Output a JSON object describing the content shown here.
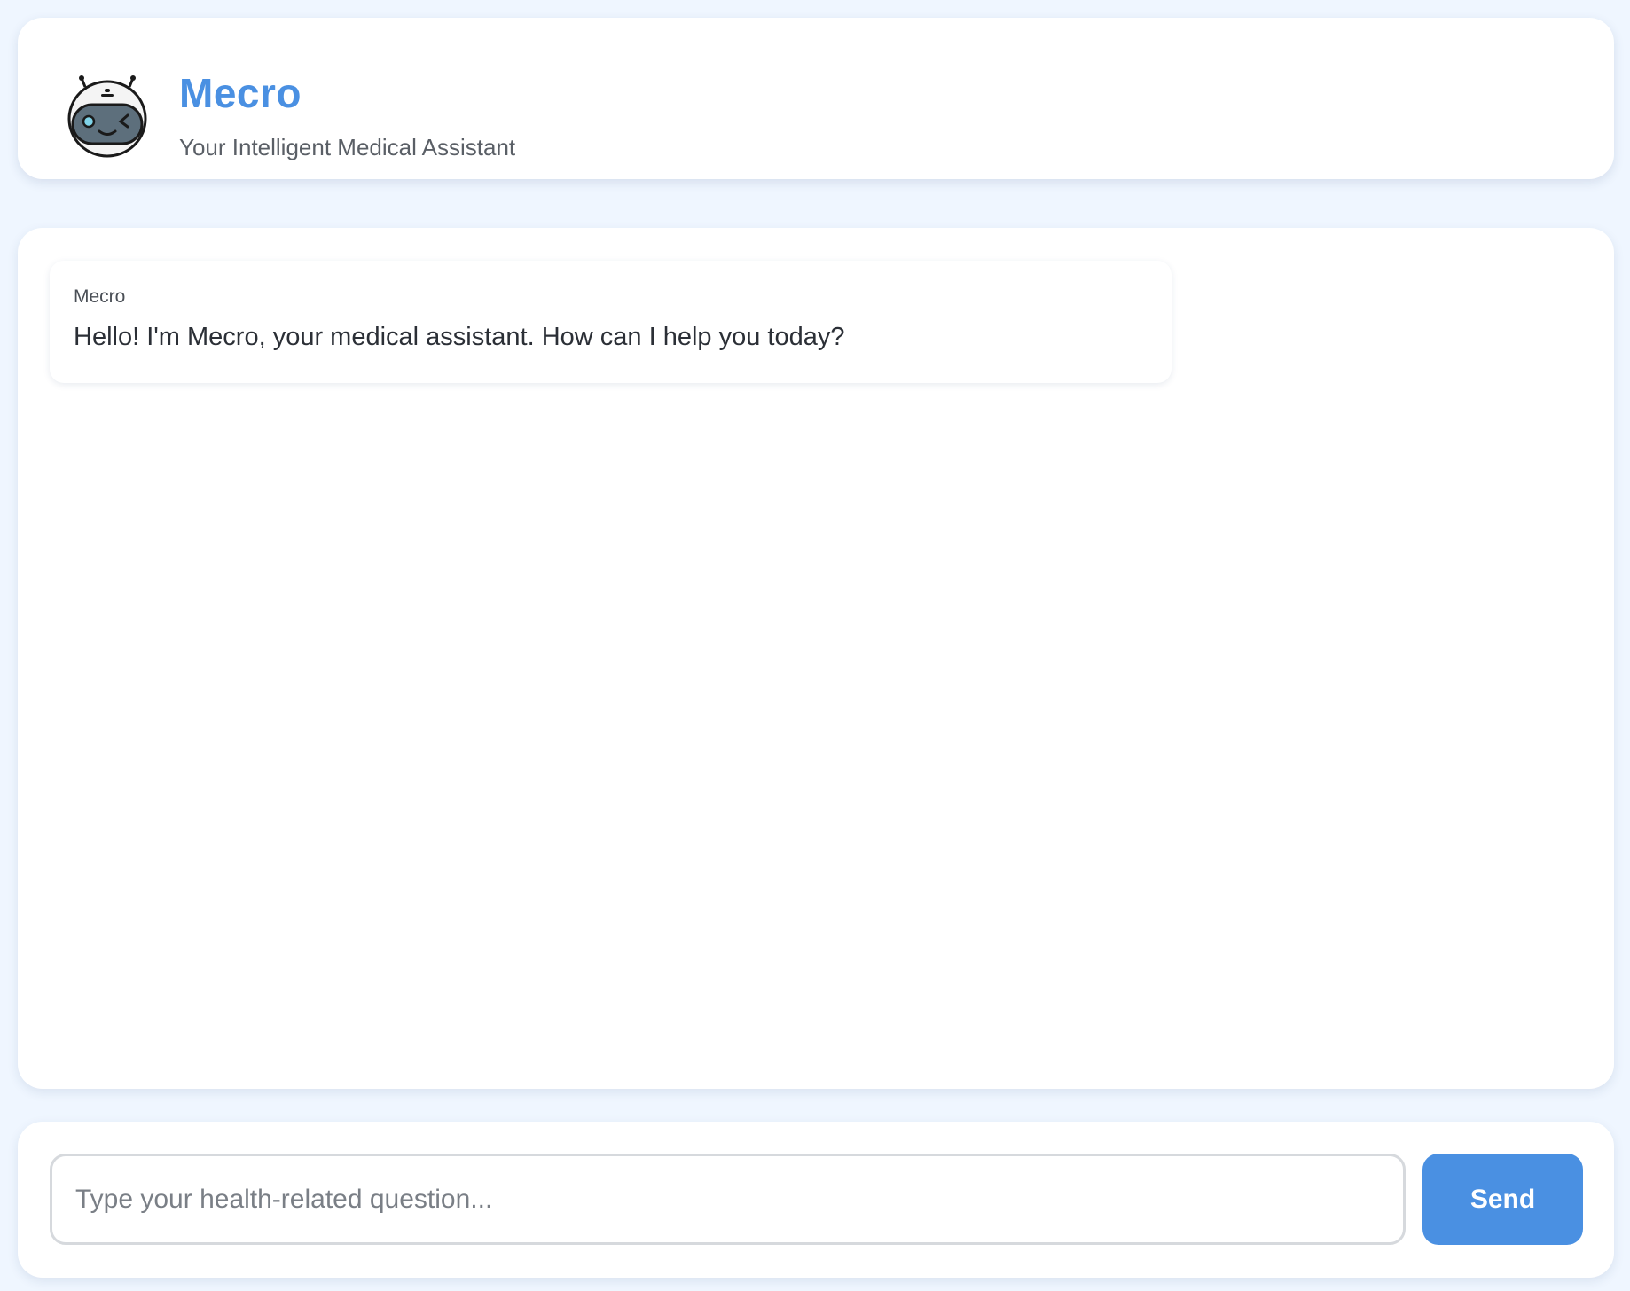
{
  "header": {
    "title": "Mecro",
    "subtitle": "Your Intelligent Medical Assistant",
    "logo_icon": "robot-avatar-icon"
  },
  "chat": {
    "messages": [
      {
        "sender": "Mecro",
        "text": "Hello! I'm Mecro, your medical assistant. How can I help you today?"
      }
    ]
  },
  "composer": {
    "input_value": "",
    "placeholder": "Type your health-related question...",
    "send_label": "Send"
  },
  "colors": {
    "accent": "#4a90e2",
    "background": "#eff6ff",
    "card": "#ffffff"
  }
}
